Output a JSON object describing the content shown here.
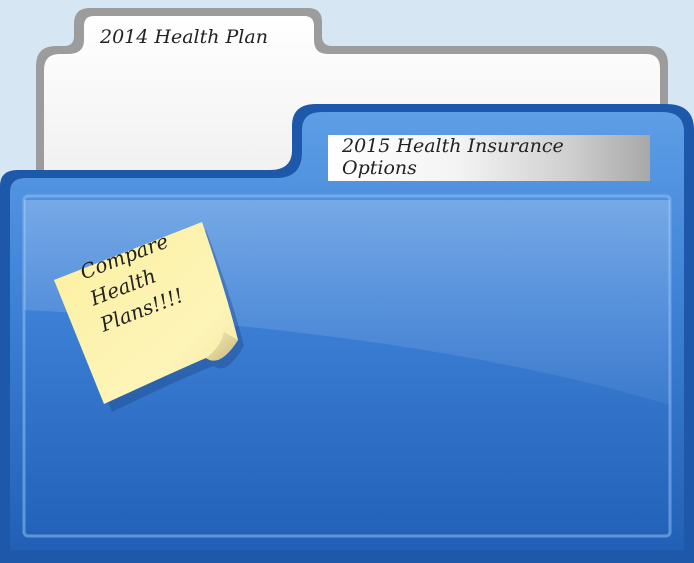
{
  "back_folder": {
    "tab_label": "2014 Health Plan"
  },
  "front_folder": {
    "label_lines": [
      "2015 Health Insurance",
      "Options"
    ]
  },
  "sticky_note": {
    "lines": [
      "Compare",
      "Health",
      "Plans!!!!"
    ]
  },
  "colors": {
    "background": "#d6e6f2",
    "folder_blue": "#3a7fd5",
    "folder_dark_blue": "#1b57a8",
    "back_folder_border": "#9a9a9a",
    "sticky_yellow": "#fdf3a8"
  }
}
